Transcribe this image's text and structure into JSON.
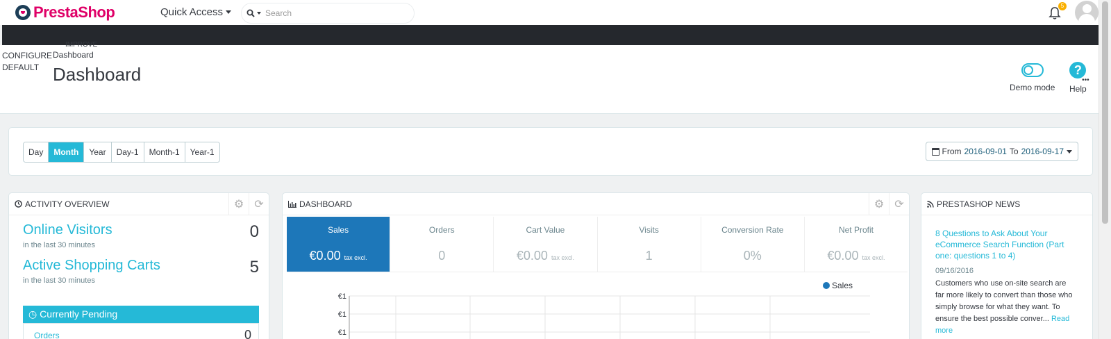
{
  "topbar": {
    "logo_text": "PrestaShop",
    "quick_access_label": "Quick Access",
    "search_placeholder": "Search",
    "notification_count": "5"
  },
  "header": {
    "breadcrumb_left_1": "CONFIGURE",
    "breadcrumb_left_2": "DEFAULT",
    "breadcrumb_improve": "IMPROVE",
    "breadcrumb_current": "Dashboard",
    "title": "Dashboard",
    "demo_mode_label": "Demo mode",
    "help_label": "Help"
  },
  "period": {
    "buttons": [
      "Day",
      "Month",
      "Year",
      "Day-1",
      "Month-1",
      "Year-1"
    ],
    "active": "Month",
    "from_label": "From",
    "from_date": "2016-09-01",
    "to_label": "To",
    "to_date": "2016-09-17"
  },
  "activity": {
    "header": "ACTIVITY OVERVIEW",
    "online_visitors_label": "Online Visitors",
    "online_visitors_sub": "in the last 30 minutes",
    "online_visitors_value": "0",
    "active_carts_label": "Active Shopping Carts",
    "active_carts_sub": "in the last 30 minutes",
    "active_carts_value": "5",
    "pending_label": "Currently Pending",
    "orders_label": "Orders",
    "orders_value": "0"
  },
  "dashboard": {
    "header": "DASHBOARD",
    "kpis": [
      {
        "label": "Sales",
        "value": "€0.00",
        "suffix": "tax excl."
      },
      {
        "label": "Orders",
        "value": "0",
        "suffix": ""
      },
      {
        "label": "Cart Value",
        "value": "€0.00",
        "suffix": "tax excl."
      },
      {
        "label": "Visits",
        "value": "1",
        "suffix": ""
      },
      {
        "label": "Conversion Rate",
        "value": "0%",
        "suffix": ""
      },
      {
        "label": "Net Profit",
        "value": "€0.00",
        "suffix": "tax excl."
      }
    ],
    "chart_legend": "Sales",
    "chart_ytick_1": "€1",
    "chart_ytick_2": "€1",
    "chart_ytick_3": "€1",
    "accent": "#1d77b9"
  },
  "news": {
    "header": "PRESTASHOP NEWS",
    "title": "8 Questions to Ask About Your eCommerce Search Function (Part one: questions 1 to 4)",
    "date": "09/16/2016",
    "body": "Customers who use on-site search are far more likely to convert than those who simply browse for what they want. To ensure the best possible conver...",
    "read_more": "Read more"
  },
  "colors": {
    "brand": "#df0067",
    "accent": "#25b9d7",
    "dark_bar": "#25282d"
  }
}
